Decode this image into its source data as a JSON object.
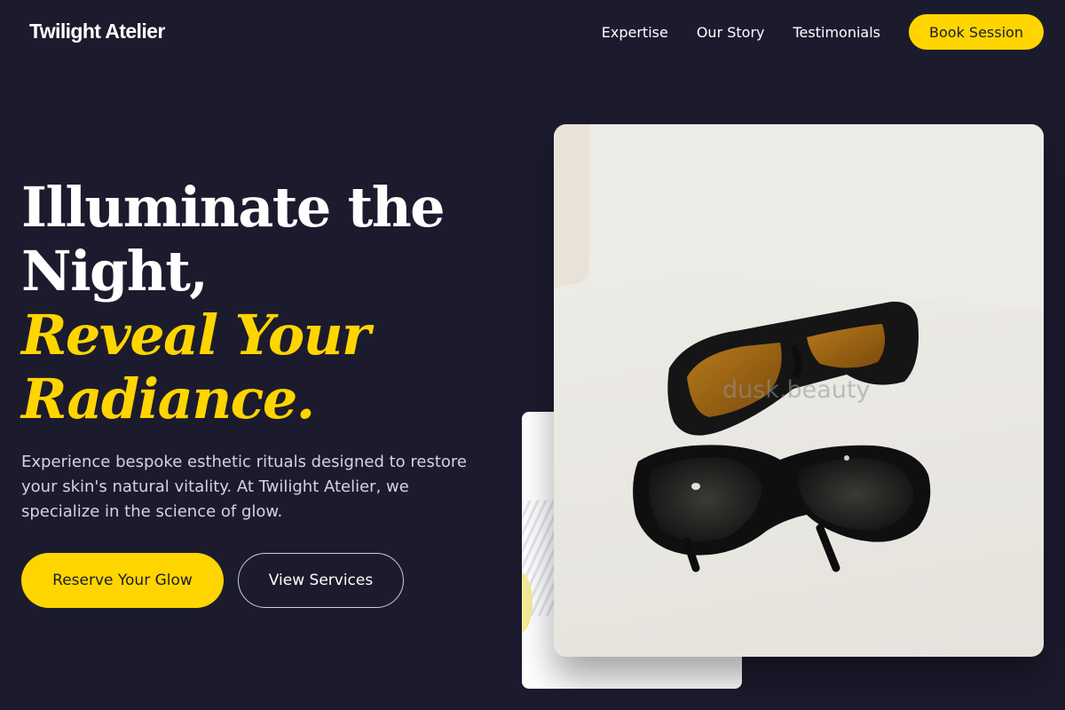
{
  "brand": {
    "name": "Twilight Atelier"
  },
  "nav": {
    "links": [
      "Expertise",
      "Our Story",
      "Testimonials"
    ],
    "cta": "Book Session"
  },
  "hero": {
    "title_line1": "Illuminate the",
    "title_line2": "Night,",
    "accent_line1": "Reveal Your",
    "accent_line2": "Radiance.",
    "description": "Experience bespoke esthetic rituals designed to restore your skin's natural vitality. At Twilight Atelier, we specialize in the science of glow.",
    "primary_cta": "Reserve Your Glow",
    "secondary_cta": "View Services"
  },
  "image": {
    "watermark": "dusk.beauty"
  },
  "colors": {
    "background": "#1c1b2e",
    "accent": "#ffd500",
    "text": "#ffffff"
  }
}
